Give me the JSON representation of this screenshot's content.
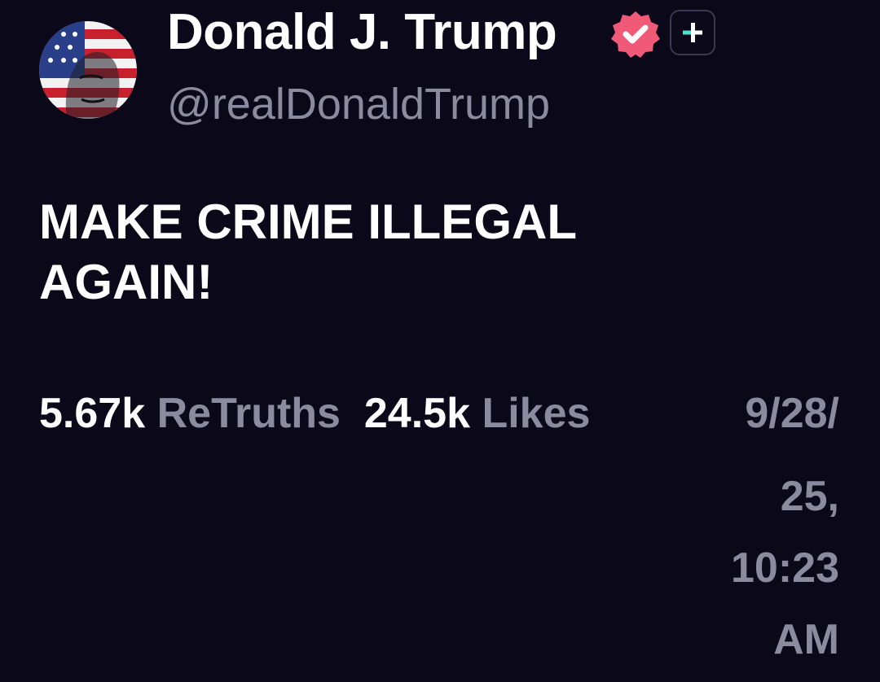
{
  "author": {
    "display_name": "Donald J. Trump",
    "handle": "@realDonaldTrump",
    "verified_icon": "verified-badge-icon",
    "verified_color": "#f05a78",
    "plus_icon": "plus-icon",
    "plus_accent": "#4fe0c8"
  },
  "post": {
    "line1": "MAKE CRIME ILLEGAL",
    "line2": "AGAIN!"
  },
  "stats": {
    "retruths_count": "5.67k",
    "retruths_label": "ReTruths",
    "likes_count": "24.5k",
    "likes_label": "Likes"
  },
  "timestamp": {
    "line1": "9/28/",
    "line2": "25,",
    "line3": "10:23",
    "line4": "AM"
  },
  "colors": {
    "background": "#0b0819",
    "muted_text": "#8c8a9e"
  }
}
